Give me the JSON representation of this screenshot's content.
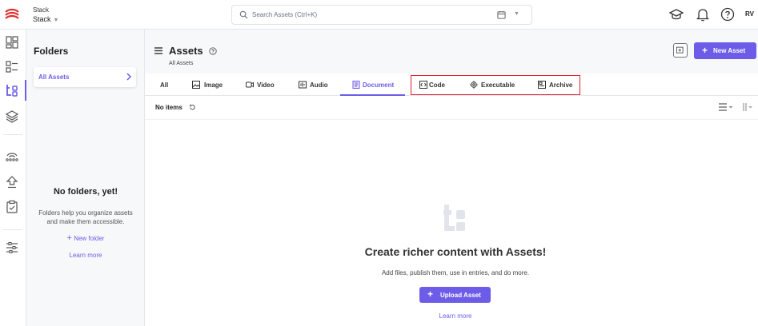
{
  "header": {
    "stack_label": "Stack",
    "stack_name": "Stack",
    "search_placeholder": "Search Assets (Ctrl+K)",
    "avatar_initials": "RV"
  },
  "folders": {
    "title": "Folders",
    "all_assets": "All Assets",
    "empty_title": "No folders, yet!",
    "empty_desc": "Folders help you organize assets and make them accessible.",
    "new_folder": "New folder",
    "learn_more": "Learn more"
  },
  "main": {
    "title": "Assets",
    "breadcrumb": "All Assets",
    "new_asset_label": "New Asset",
    "tabs": [
      {
        "label": "All",
        "icon": "none"
      },
      {
        "label": "Image",
        "icon": "image-icon"
      },
      {
        "label": "Video",
        "icon": "video-icon"
      },
      {
        "label": "Audio",
        "icon": "audio-icon"
      },
      {
        "label": "Document",
        "icon": "document-icon",
        "active": true
      },
      {
        "label": "Code",
        "icon": "code-icon"
      },
      {
        "label": "Executable",
        "icon": "gear-icon"
      },
      {
        "label": "Archive",
        "icon": "archive-icon"
      }
    ],
    "no_items": "No items",
    "empty_title": "Create richer content with Assets!",
    "empty_desc": "Add files, publish them, use in entries, and do more.",
    "upload_label": "Upload Asset",
    "learn_more": "Learn more"
  },
  "colors": {
    "accent": "#6c5ce7",
    "highlight": "#e0202c",
    "panel_bg": "#f7f8fa"
  }
}
